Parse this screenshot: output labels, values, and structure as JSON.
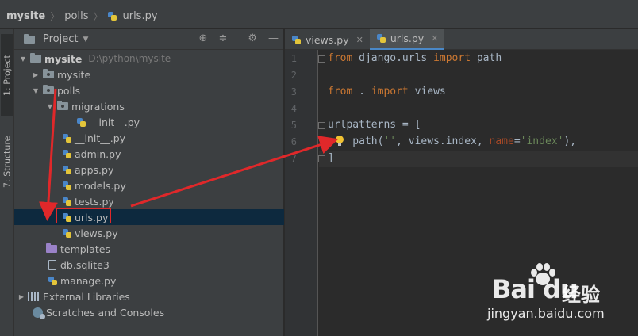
{
  "navbar": {
    "crumbs": [
      "mysite",
      "polls",
      "urls.py"
    ]
  },
  "toolstrip": {
    "project_tab": "1: Project",
    "structure_tab": "7: Structure"
  },
  "project_panel": {
    "title": "Project",
    "tree": [
      {
        "label": "mysite",
        "note": "D:\\python\\mysite",
        "kind": "root-folder",
        "expanded": true
      },
      {
        "label": "mysite",
        "kind": "package",
        "expanded": false
      },
      {
        "label": "polls",
        "kind": "package",
        "expanded": true
      },
      {
        "label": "migrations",
        "kind": "package",
        "expanded": true
      },
      {
        "label": "__init__.py",
        "kind": "python-file"
      },
      {
        "label": "__init__.py",
        "kind": "python-file"
      },
      {
        "label": "admin.py",
        "kind": "python-file"
      },
      {
        "label": "apps.py",
        "kind": "python-file"
      },
      {
        "label": "models.py",
        "kind": "python-file"
      },
      {
        "label": "tests.py",
        "kind": "python-file"
      },
      {
        "label": "urls.py",
        "kind": "python-file",
        "selected": true
      },
      {
        "label": "views.py",
        "kind": "python-file"
      },
      {
        "label": "templates",
        "kind": "template-folder"
      },
      {
        "label": "db.sqlite3",
        "kind": "database-file"
      },
      {
        "label": "manage.py",
        "kind": "python-file"
      },
      {
        "label": "External Libraries",
        "kind": "libraries",
        "expanded": false
      },
      {
        "label": "Scratches and Consoles",
        "kind": "scratches"
      }
    ]
  },
  "editor": {
    "tabs": [
      {
        "label": "views.py",
        "active": false
      },
      {
        "label": "urls.py",
        "active": true
      }
    ],
    "line_numbers": [
      "1",
      "2",
      "3",
      "4",
      "5",
      "6",
      "7"
    ],
    "lines": [
      {
        "tokens": [
          [
            "kw",
            "from"
          ],
          [
            "plain",
            " django.urls "
          ],
          [
            "kw",
            "import"
          ],
          [
            "plain",
            " path"
          ]
        ]
      },
      {
        "tokens": []
      },
      {
        "tokens": [
          [
            "kw",
            "from"
          ],
          [
            "plain",
            " . "
          ],
          [
            "kw",
            "import"
          ],
          [
            "plain",
            " views"
          ]
        ]
      },
      {
        "tokens": []
      },
      {
        "tokens": [
          [
            "plain",
            "urlpatterns = ["
          ]
        ]
      },
      {
        "tokens": [
          [
            "plain",
            "    path("
          ],
          [
            "str",
            "''"
          ],
          [
            "plain",
            ", views.index, "
          ],
          [
            "param",
            "name"
          ],
          [
            "plain",
            "="
          ],
          [
            "str",
            "'index'"
          ],
          [
            "plain",
            "),"
          ]
        ]
      },
      {
        "tokens": [
          [
            "plain",
            "]"
          ]
        ]
      }
    ]
  },
  "annotations": {
    "arrow_color": "#e0282a"
  },
  "watermark": {
    "logo": "Bai du",
    "brand": "经验",
    "url": "jingyan.baidu.com"
  }
}
